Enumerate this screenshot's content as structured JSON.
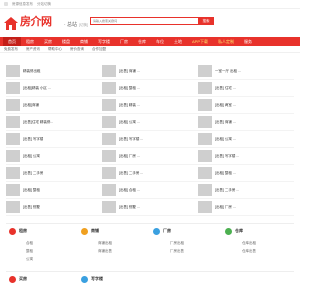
{
  "topbar": {
    "links": [
      "房源信息发布",
      "分站切换"
    ]
  },
  "header": {
    "logo_text": "房介网",
    "city": "· 总站",
    "city_switch": "[切换]",
    "search_placeholder": "请输入搜索关键词",
    "search_button": "搜索"
  },
  "nav": {
    "items": [
      {
        "label": "首页",
        "active": true
      },
      {
        "label": "租房"
      },
      {
        "label": "买房"
      },
      {
        "label": "楼盘"
      },
      {
        "label": "商铺"
      },
      {
        "label": "写字楼"
      },
      {
        "label": "厂房"
      },
      {
        "label": "仓库"
      },
      {
        "label": "车位"
      },
      {
        "label": "土地"
      },
      {
        "label": "APP下载",
        "yellow": true
      },
      {
        "label": "私人定制",
        "yellow": true
      },
      {
        "label": "服务"
      }
    ]
  },
  "subnav": [
    "免费发布",
    "房产资讯",
    "帮助中心",
    "房价查询",
    "合作加盟"
  ],
  "listings": {
    "col1": [
      {
        "title": "精装修出租",
        "meta": "",
        "price": ""
      },
      {
        "title": "[出租]精装 小区 ...",
        "meta": "",
        "price": ""
      },
      {
        "title": "[出租]商铺",
        "meta": "",
        "price": ""
      },
      {
        "title": "[出售]住宅 精装修...",
        "meta": "",
        "price": ""
      },
      {
        "title": "[出售] 写字楼",
        "meta": "",
        "price": ""
      },
      {
        "title": "[出租] 公寓",
        "meta": "",
        "price": ""
      },
      {
        "title": "[出售] 二手房",
        "meta": "",
        "price": ""
      },
      {
        "title": "[出租] 整租",
        "meta": "",
        "price": ""
      },
      {
        "title": "[出售] 别墅",
        "meta": "",
        "price": ""
      }
    ],
    "col2": [
      {
        "title": "[出售] 商铺 ...",
        "meta": "",
        "price": ""
      },
      {
        "title": "[出租] 整租 ...",
        "meta": "",
        "price": ""
      },
      {
        "title": "[出售] 精装 ...",
        "meta": "",
        "price": ""
      },
      {
        "title": "[出租] 公寓 ...",
        "meta": "",
        "price": ""
      },
      {
        "title": "[出售] 写字楼 ...",
        "meta": "",
        "price": ""
      },
      {
        "title": "[出租] 厂房 ...",
        "meta": "",
        "price": ""
      },
      {
        "title": "[出售] 二手房 ...",
        "meta": "",
        "price": ""
      },
      {
        "title": "[出租] 合租 ...",
        "meta": "",
        "price": ""
      },
      {
        "title": "[出售] 别墅 ...",
        "meta": "",
        "price": ""
      }
    ],
    "col3": [
      {
        "title": "一室一厅 出租 ...",
        "meta": "",
        "price": ""
      },
      {
        "title": "[出售] 住宅 ...",
        "meta": "",
        "price": ""
      },
      {
        "title": "[出租] 两室 ...",
        "meta": "",
        "price": ""
      },
      {
        "title": "[出售] 商铺 ...",
        "meta": "",
        "price": ""
      },
      {
        "title": "[出租] 公寓 ...",
        "meta": "",
        "price": ""
      },
      {
        "title": "[出售] 写字楼 ...",
        "meta": "",
        "price": ""
      },
      {
        "title": "[出租] 整租 ...",
        "meta": "",
        "price": ""
      },
      {
        "title": "[出售] 二手房 ...",
        "meta": "",
        "price": ""
      },
      {
        "title": "[出租] 厂房 ...",
        "meta": "",
        "price": ""
      }
    ]
  },
  "categories": {
    "row1": [
      {
        "name": "租房",
        "color": "#e8322b",
        "subs": [
          "合租",
          "整租",
          "公寓"
        ]
      },
      {
        "name": "商铺",
        "color": "#f0a020",
        "subs": [
          "商铺出租",
          "商铺出售"
        ]
      },
      {
        "name": "厂房",
        "color": "#3aa0e0",
        "subs": [
          "厂房出租",
          "厂房出售"
        ]
      },
      {
        "name": "仓库",
        "color": "#4cb050",
        "subs": [
          "仓库出租",
          "仓库出售"
        ]
      }
    ],
    "row2": [
      {
        "name": "买房",
        "color": "#e8322b",
        "subs": []
      },
      {
        "name": "写字楼",
        "color": "#3aa0e0",
        "subs": []
      }
    ]
  }
}
